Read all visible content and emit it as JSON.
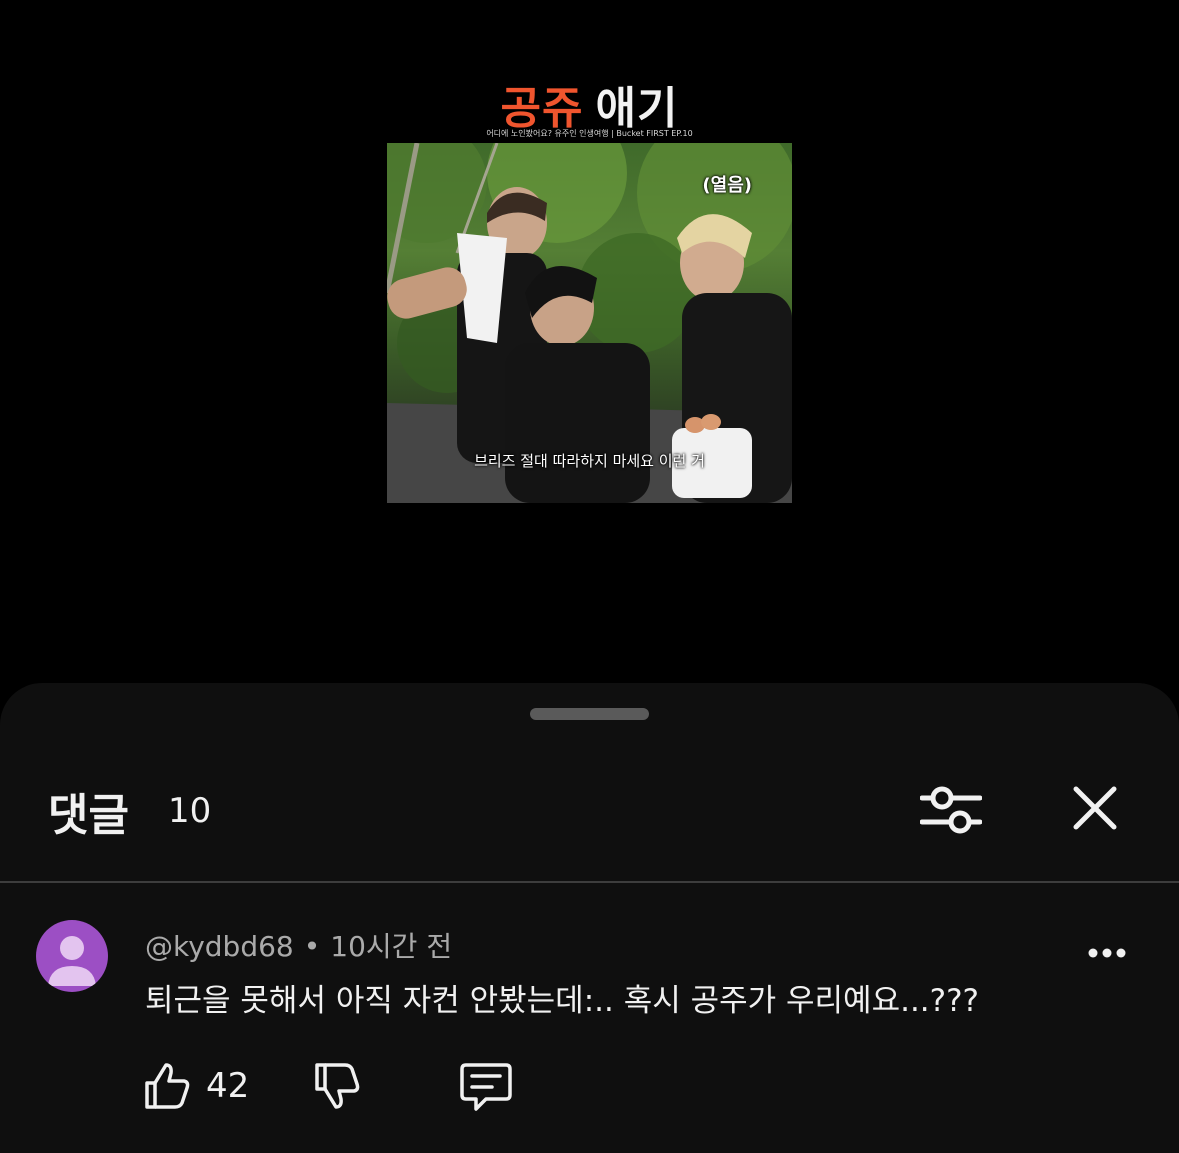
{
  "video": {
    "title_part1": "공쥬",
    "title_part2": "애기",
    "subtitle": "어디에 노인봤어요? 유주인 인생여행 | Bucket FIRST EP.10",
    "caption_top": "(열음)",
    "caption_bottom": "브리즈 절대 따라하지 마세요 이런 거"
  },
  "comments_panel": {
    "title": "댓글",
    "count": "10",
    "filter_icon": "sliders-icon",
    "close_icon": "close-icon"
  },
  "comment": {
    "author": "@kydbd68",
    "separator": "•",
    "time": "10시간 전",
    "text": "퇴근을 못해서 아직 자컨 안봤는데:.. 혹시 공주가 우리예요...???",
    "likes": "42",
    "more_icon": "more-icon"
  },
  "colors": {
    "title_accent": "#f0552e",
    "sheet_bg": "#0f0f0f",
    "avatar_bg": "#9c4fc4",
    "meta_text": "#aaaaaa"
  }
}
